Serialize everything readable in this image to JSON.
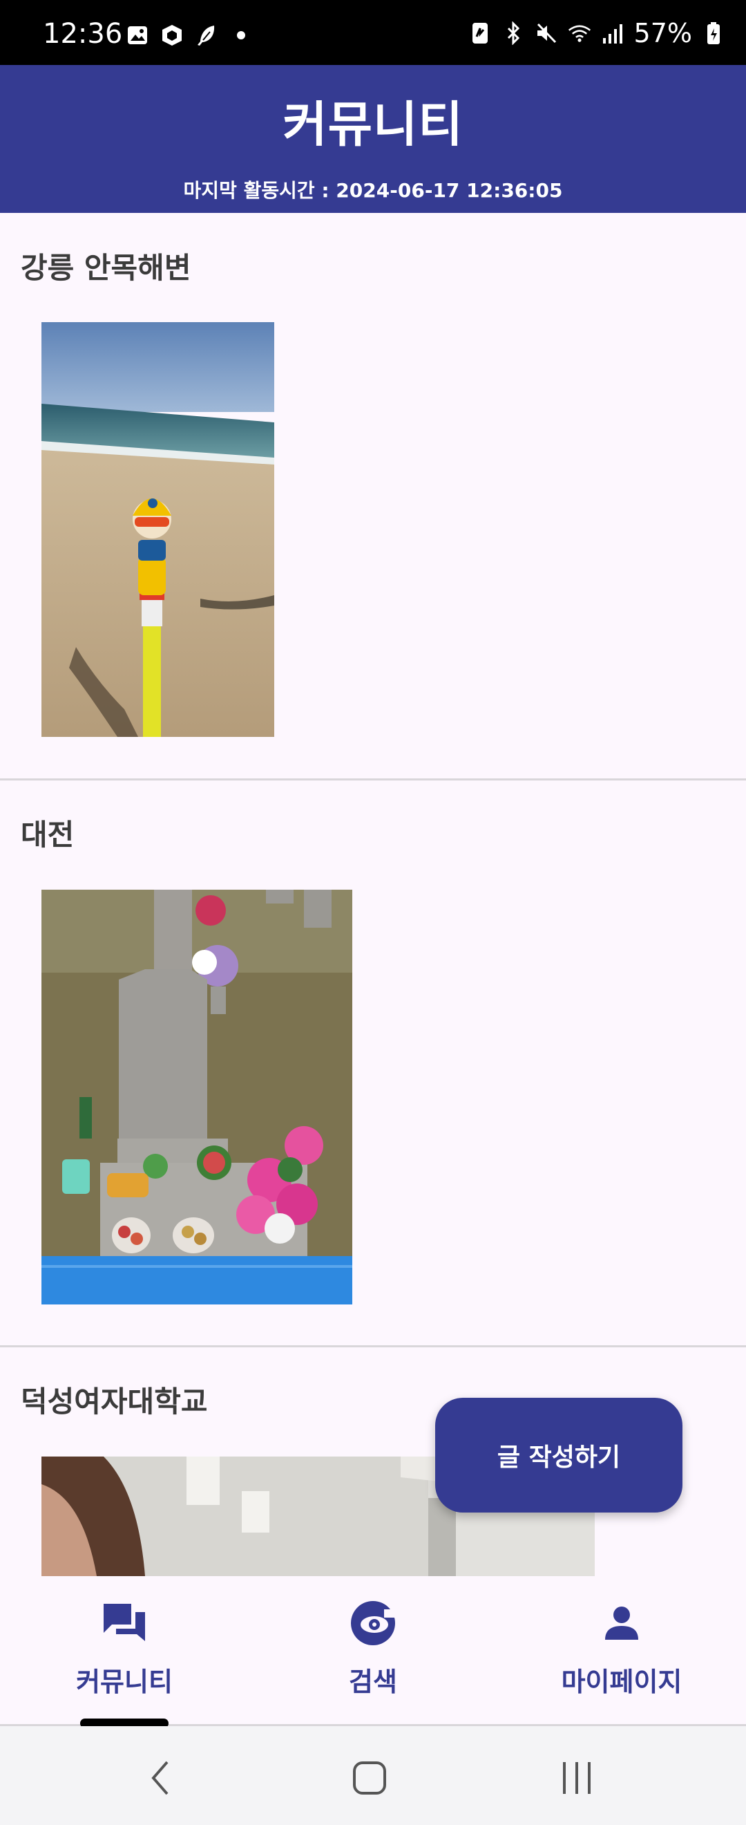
{
  "status_bar": {
    "time": "12:36",
    "battery": "57%",
    "icons": [
      "image-icon",
      "package-icon",
      "feather-icon",
      "dot-icon",
      "nfc-icon",
      "bluetooth-icon",
      "mute-icon",
      "wifi-icon",
      "signal-icon",
      "battery-icon"
    ]
  },
  "header": {
    "title": "커뮤니티",
    "last_activity": "마지막 활동시간 : 2024-06-17 12:36:05"
  },
  "posts": [
    {
      "title": "강릉 안목해변",
      "photo": "beach-toy-photo"
    },
    {
      "title": "대전",
      "photo": "memorial-grave-photo"
    },
    {
      "title": "덕성여자대학교",
      "photo": "indoor-person-photo"
    }
  ],
  "fab": {
    "label": "글 작성하기"
  },
  "bottom_nav": {
    "items": [
      {
        "label": "커뮤니티",
        "icon": "forum-icon",
        "selected": true
      },
      {
        "label": "검색",
        "icon": "search-eye-icon",
        "selected": false
      },
      {
        "label": "마이페이지",
        "icon": "person-icon",
        "selected": false
      }
    ]
  },
  "system_nav": {
    "icons": [
      "back-icon",
      "home-icon",
      "recents-icon"
    ]
  },
  "colors": {
    "primary": "#353b92",
    "background": "#fdf7fe",
    "divider": "#d9d6da"
  }
}
